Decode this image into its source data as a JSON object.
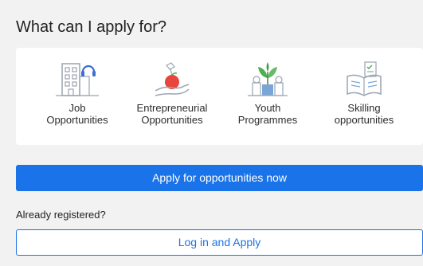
{
  "heading": "What can I apply for?",
  "opportunities": [
    {
      "icon": "office-building-icon",
      "line1": "Job",
      "line2": "Opportunities"
    },
    {
      "icon": "hand-with-apple-icon",
      "line1": "Entrepreneurial",
      "line2": "Opportunities"
    },
    {
      "icon": "seedling-plant-icon",
      "line1": "Youth",
      "line2": "Programmes"
    },
    {
      "icon": "open-book-checklist-icon",
      "line1": "Skilling",
      "line2": "opportunities"
    }
  ],
  "apply_button": "Apply for opportunities now",
  "registered_text": "Already registered?",
  "login_button": "Log in and Apply",
  "colors": {
    "accent": "#1a73e8",
    "background": "#f2f2f3",
    "card": "#ffffff",
    "apple_red": "#e8453c",
    "leaf_green": "#4caf50",
    "icon_blue": "#7aa6d6"
  }
}
